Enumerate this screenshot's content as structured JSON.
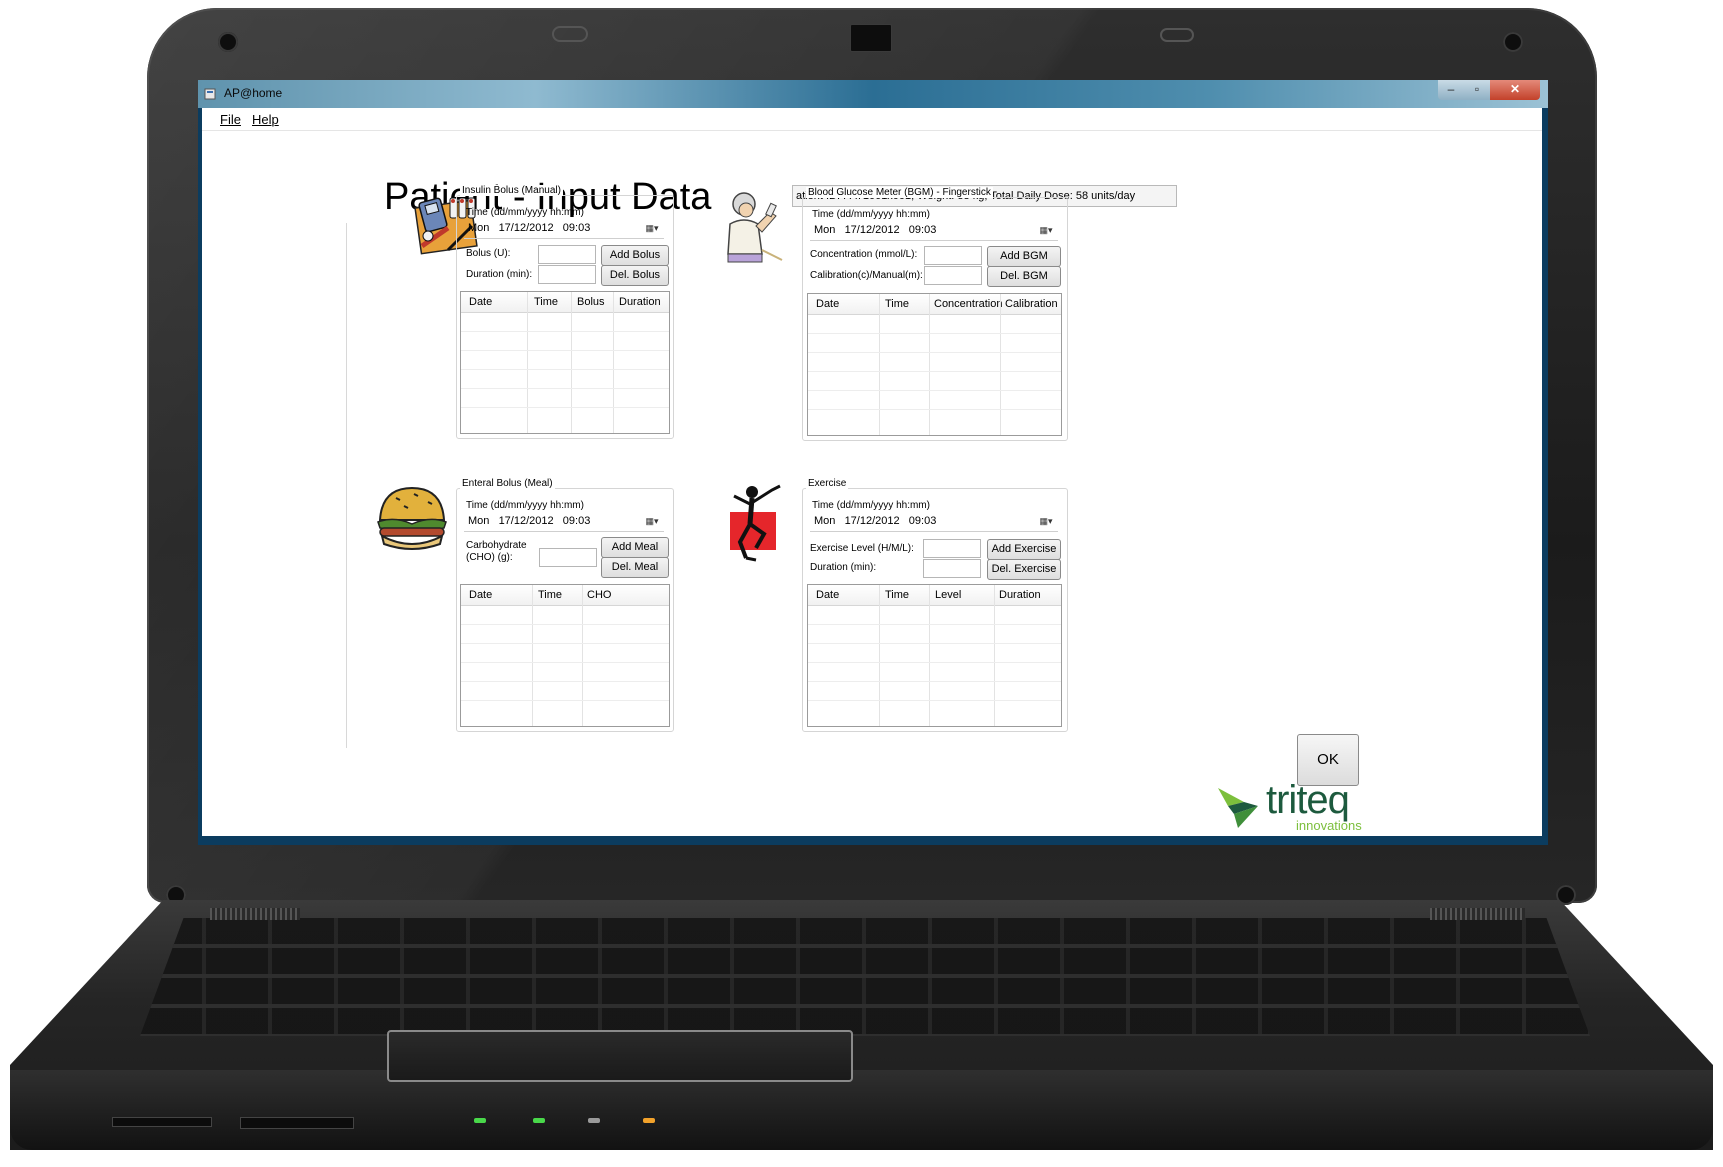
{
  "window": {
    "title": "AP@home"
  },
  "menu": {
    "file": "File",
    "help": "Help"
  },
  "page": {
    "title": "Patient - Input Data",
    "patient_info": "atient ID: PAT1001x001, Weight: 83 kg, Total Daily Dose: 58 units/day"
  },
  "insulin": {
    "group_label": "Insulin Bolus (Manual)",
    "time_label": "Time (dd/mm/yyyy hh:mm)",
    "datetime": "Mon   17/12/2012   09:03",
    "bolus_label": "Bolus (U):",
    "duration_label": "Duration (min):",
    "add_button": "Add Bolus",
    "del_button": "Del. Bolus",
    "columns": [
      "Date",
      "Time",
      "Bolus",
      "Duration"
    ]
  },
  "bgm": {
    "group_label": "Blood Glucose Meter (BGM) - Fingerstick",
    "time_label": "Time (dd/mm/yyyy hh:mm)",
    "datetime": "Mon   17/12/2012   09:03",
    "concentration_label": "Concentration (mmol/L):",
    "calibration_label": "Calibration(c)/Manual(m):",
    "add_button": "Add BGM",
    "del_button": "Del. BGM",
    "columns": [
      "Date",
      "Time",
      "Concentration",
      "Calibration"
    ]
  },
  "meal": {
    "group_label": "Enteral Bolus (Meal)",
    "time_label": "Time (dd/mm/yyyy hh:mm)",
    "datetime": "Mon   17/12/2012   09:03",
    "cho_label_line1": "Carbohydrate",
    "cho_label_line2": "(CHO) (g):",
    "add_button": "Add Meal",
    "del_button": "Del. Meal",
    "columns": [
      "Date",
      "Time",
      "CHO"
    ]
  },
  "exercise": {
    "group_label": "Exercise",
    "time_label": "Time (dd/mm/yyyy hh:mm)",
    "datetime": "Mon   17/12/2012   09:03",
    "level_label": "Exercise Level (H/M/L):",
    "duration_label": "Duration (min):",
    "add_button": "Add Exercise",
    "del_button": "Del. Exercise",
    "columns": [
      "Date",
      "Time",
      "Level",
      "Duration"
    ]
  },
  "ok_button": "OK",
  "logo": {
    "name": "triteq",
    "tagline": "innovations",
    "color_primary": "#1d5a3e",
    "color_accent": "#7cbf3c"
  },
  "icons": {
    "insulin": "insulin-supplies-icon",
    "bgm": "fingerstick-person-icon",
    "meal": "burger-icon",
    "exercise": "exercise-person-icon",
    "calendar": "calendar-dropdown-icon"
  }
}
